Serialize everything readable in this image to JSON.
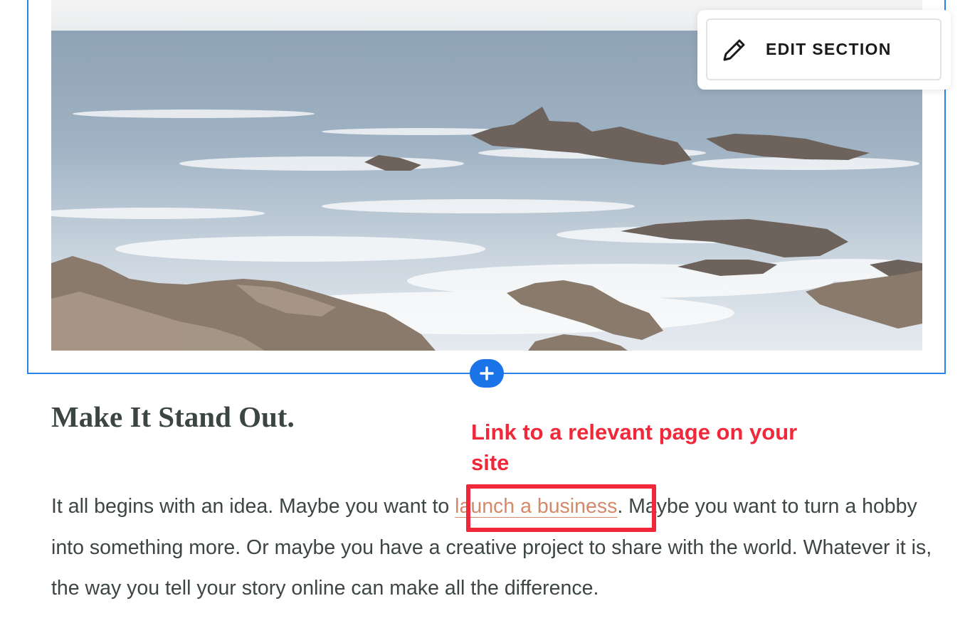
{
  "edit_panel": {
    "button_label": "EDIT SECTION",
    "icon": "pencil-icon"
  },
  "add_section": {
    "icon": "plus-icon"
  },
  "content": {
    "heading": "Make It Stand Out.",
    "paragraph_before": "It all begins with an idea. Maybe you want to ",
    "link_text": "launch a business",
    "paragraph_after": ". Maybe you want to turn a hobby into something more. Or maybe you have a creative project to share with the world. Whatever it is, the way you tell your story online can make all the difference."
  },
  "annotation": {
    "text": "Link to a relevant page on your site"
  },
  "colors": {
    "selection_outline": "#2b83ea",
    "add_button": "#1a74e8",
    "annotation_red": "#f0283a",
    "link": "#d4896a",
    "heading": "#3b4541",
    "body_text": "#3d4643"
  }
}
